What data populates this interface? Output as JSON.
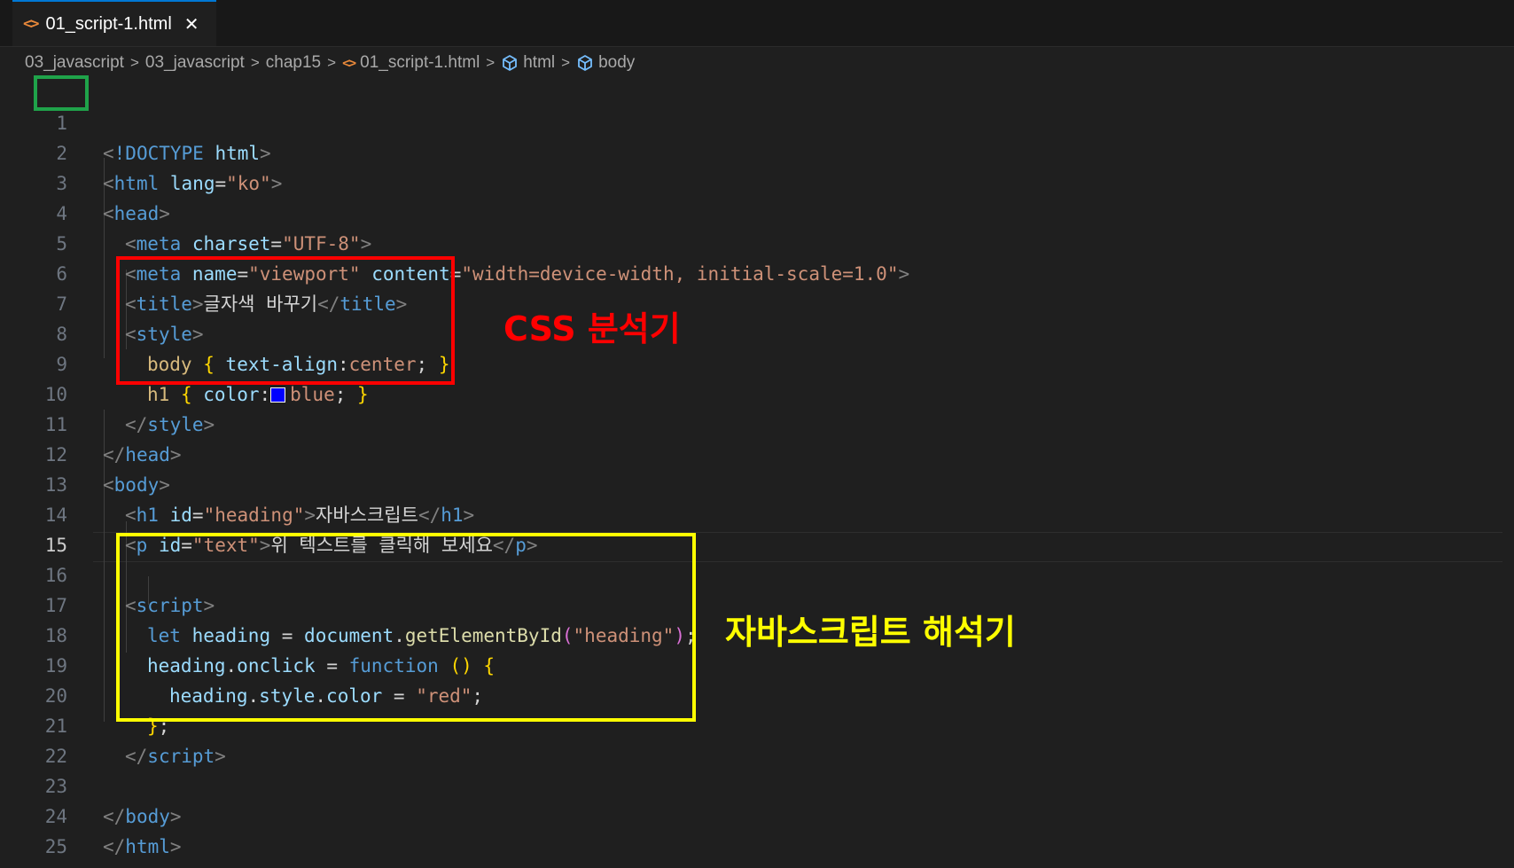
{
  "tab": {
    "file_icon": "<>",
    "label": "01_script-1.html",
    "close_icon": "✕"
  },
  "breadcrumb": {
    "items": [
      "03_javascript",
      "03_javascript",
      "chap15",
      "01_script-1.html",
      "html",
      "body"
    ],
    "separator": ">",
    "file_icon": "<>"
  },
  "editor": {
    "active_line": 15,
    "line_numbers": [
      "1",
      "2",
      "3",
      "4",
      "5",
      "6",
      "7",
      "8",
      "9",
      "10",
      "11",
      "12",
      "13",
      "14",
      "15",
      "16",
      "17",
      "18",
      "19",
      "20",
      "21",
      "22",
      "23",
      "24",
      "25"
    ],
    "code": {
      "l1": {
        "open": "<",
        "bang": "!DOCTYPE",
        "sp": " ",
        "kw": "html",
        "close": ">"
      },
      "l2": {
        "open": "<",
        "tag": "html",
        "sp": " ",
        "attr": "lang",
        "eq": "=",
        "val": "\"ko\"",
        "close": ">"
      },
      "l3": {
        "open": "<",
        "tag": "head",
        "close": ">"
      },
      "l4": {
        "open": "<",
        "tag": "meta",
        "sp": " ",
        "attr": "charset",
        "eq": "=",
        "val": "\"UTF-8\"",
        "close": ">"
      },
      "l5": {
        "open": "<",
        "tag": "meta",
        "sp": " ",
        "attr1": "name",
        "eq1": "=",
        "val1": "\"viewport\"",
        "sp2": " ",
        "attr2": "content",
        "eq2": "=",
        "val2": "\"width=device-width, initial-scale=1.0\"",
        "close": ">"
      },
      "l6": {
        "open": "<",
        "tag": "title",
        "close": ">",
        "text": "글자색 바꾸기",
        "end_open": "</",
        "end_tag": "title",
        "end_close": ">"
      },
      "l7": {
        "open": "<",
        "tag": "style",
        "close": ">"
      },
      "l8": {
        "sel": "body",
        "sp": " ",
        "lb": "{",
        "sp2": " ",
        "prop": "text-align",
        "colon": ":",
        "val": "center",
        "semi": ";",
        "sp3": " ",
        "rb": "}"
      },
      "l9": {
        "sel": "h1",
        "sp": " ",
        "lb": "{",
        "sp2": " ",
        "prop": "color",
        "colon": ":",
        "val": "blue",
        "semi": ";",
        "sp3": " ",
        "rb": "}",
        "swatch_color": "#0000ff"
      },
      "l10": {
        "open": "</",
        "tag": "style",
        "close": ">"
      },
      "l11": {
        "open": "</",
        "tag": "head",
        "close": ">"
      },
      "l12": {
        "open": "<",
        "tag": "body",
        "close": ">"
      },
      "l13": {
        "open": "<",
        "tag": "h1",
        "sp": " ",
        "attr": "id",
        "eq": "=",
        "val": "\"heading\"",
        "close": ">",
        "text": "자바스크립트",
        "end_open": "</",
        "end_tag": "h1",
        "end_close": ">"
      },
      "l14": {
        "open": "<",
        "tag": "p",
        "sp": " ",
        "attr": "id",
        "eq": "=",
        "val": "\"text\"",
        "close": ">",
        "text": "위 텍스트를 클릭해 보세요",
        "end_open": "</",
        "end_tag": "p",
        "end_close": ">"
      },
      "l16": {
        "open": "<",
        "tag": "script",
        "close": ">"
      },
      "l17": {
        "kw": "let",
        "sp": " ",
        "var": "heading",
        "op": " = ",
        "obj": "document",
        "dot": ".",
        "fn": "getElementById",
        "lp": "(",
        "str": "\"heading\"",
        "rp": ")",
        "semi": ";"
      },
      "l18": {
        "var": "heading",
        "dot": ".",
        "prop": "onclick",
        "op": " = ",
        "kw": "function",
        "sp": " ",
        "parens": "()",
        "sp2": " ",
        "lb": "{"
      },
      "l19": {
        "var": "heading",
        "dot1": ".",
        "prop1": "style",
        "dot2": ".",
        "prop2": "color",
        "op": " = ",
        "str": "\"red\"",
        "semi": ";"
      },
      "l20": {
        "rb": "}",
        "semi": ";"
      },
      "l21": {
        "open": "</",
        "tag": "script",
        "close": ">"
      },
      "l23": {
        "open": "</",
        "tag": "body",
        "close": ">"
      },
      "l24": {
        "open": "</",
        "tag": "html",
        "close": ">"
      }
    }
  },
  "annotations": {
    "css_label": "CSS 분석기",
    "js_label": "자바스크립트 해석기",
    "colors": {
      "green_box": "#1fa34a",
      "red_box": "#ff0000",
      "yellow_box": "#ffff00"
    }
  }
}
